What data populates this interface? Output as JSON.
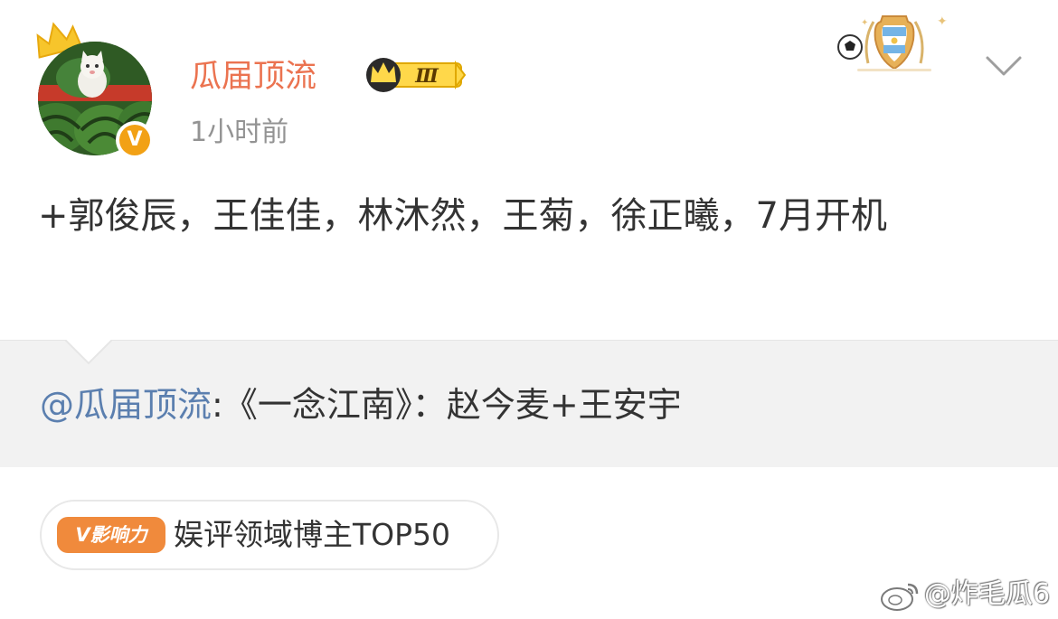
{
  "post": {
    "author": {
      "name": "瓜届顶流",
      "rank_numeral": "Ⅲ",
      "verified_mark": "V"
    },
    "timestamp": "1小时前",
    "text": "+郭俊辰，王佳佳，林沐然，王菊，徐正曦，7月开机",
    "repost": {
      "mention": "@瓜届顶流",
      "content": ":《一念江南》：赵今麦+王安宇"
    },
    "influence": {
      "badge": "V影响力",
      "label": "娱评领域博主TOP50"
    }
  },
  "watermark": {
    "text": "@炸毛瓜6"
  },
  "icons": {
    "crown": "crown-icon",
    "rank": "rank-crown-badge-icon",
    "medal": "football-medal-icon",
    "expand": "chevron-down-icon",
    "verified": "verified-badge-icon",
    "weibo": "weibo-logo-icon"
  },
  "colors": {
    "username": "#eb7350",
    "mention": "#5b7faf",
    "timestamp": "#939393",
    "repost_bg": "#f2f2f2",
    "verified": "#f2a115",
    "influence": "#f08a3c"
  }
}
